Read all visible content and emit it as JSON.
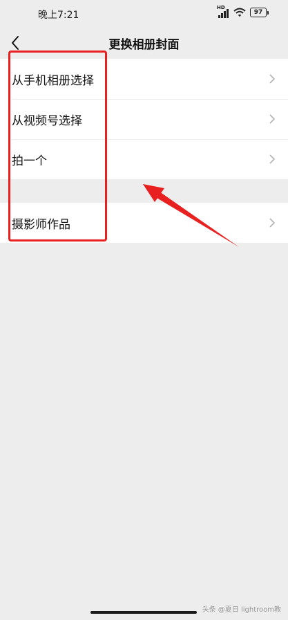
{
  "status_bar": {
    "time": "晚上7:21",
    "network_badge": "HD",
    "battery": "97",
    "icons": [
      "signal-icon",
      "wifi-icon",
      "battery-icon"
    ]
  },
  "nav": {
    "title": "更换相册封面",
    "back_icon": "chevron-left-icon"
  },
  "menu": {
    "group1": [
      {
        "label": "从手机相册选择"
      },
      {
        "label": "从视频号选择"
      },
      {
        "label": "拍一个"
      }
    ],
    "group2": [
      {
        "label": "摄影师作品"
      }
    ]
  },
  "watermark": "头条 @夏日  lightroom教",
  "colors": {
    "background": "#ededed",
    "surface": "#ffffff",
    "annotation": "#e82020",
    "chevron": "#b2b2b2"
  }
}
